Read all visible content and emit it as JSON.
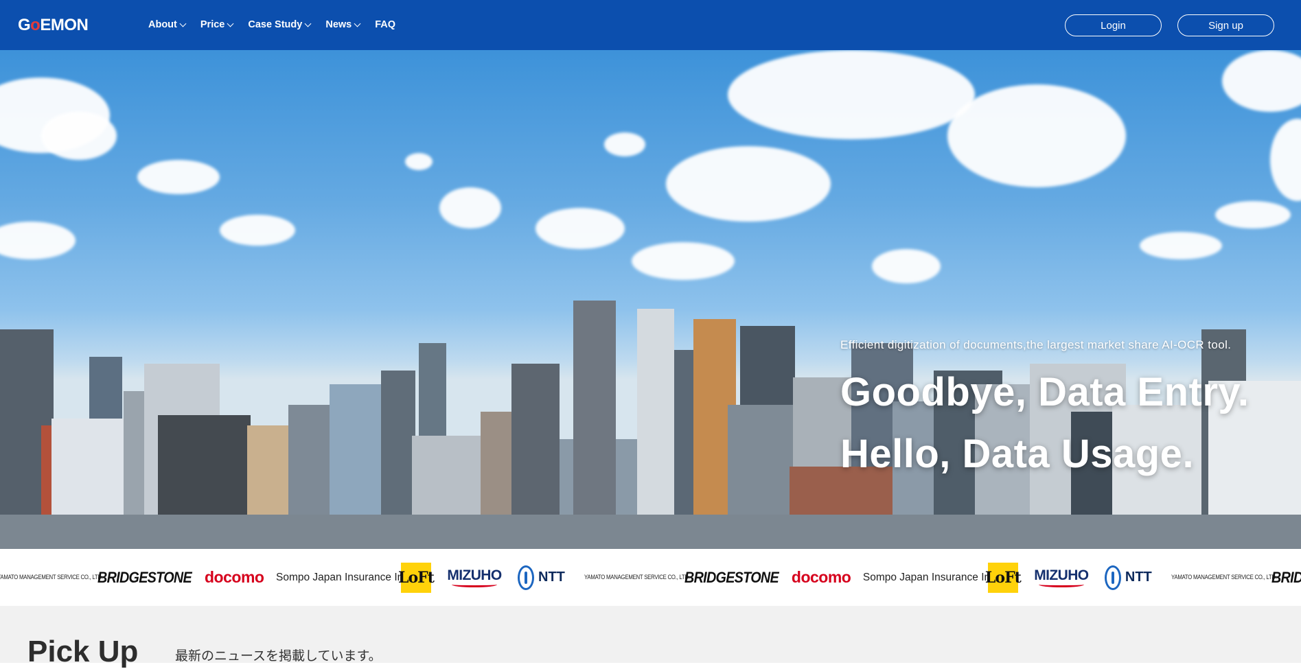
{
  "header": {
    "logo": {
      "part1": "G",
      "part2": "o",
      "part3": "EMON"
    },
    "nav": [
      {
        "label": "About",
        "dropdown": true
      },
      {
        "label": "Price",
        "dropdown": true
      },
      {
        "label": "Case Study",
        "dropdown": true
      },
      {
        "label": "News",
        "dropdown": true
      },
      {
        "label": "FAQ",
        "dropdown": false
      }
    ],
    "login_label": "Login",
    "signup_label": "Sign up"
  },
  "hero": {
    "tagline": "Efficient digitization of documents,the largest market share AI-OCR tool.",
    "headline_1": "Goodbye, Data Entry.",
    "headline_2": "Hello, Data Usage."
  },
  "clients": {
    "yamato": "YAMATO MANAGEMENT SERVICE CO., LTD.",
    "bridgestone": "BRIDGESTONE",
    "docomo": "docomo",
    "sompo": "Sompo Japan Insurance Inc.",
    "loft": "LoFt",
    "mizuho": "MIZUHO",
    "ntt": "NTT"
  },
  "pickup": {
    "title": "Pick Up",
    "subtitle": "最新のニュースを掲載しています。"
  },
  "colors": {
    "header_bg": "#0c4fae",
    "accent_red": "#e43b3b",
    "pickup_bg": "#f1f1f1"
  }
}
